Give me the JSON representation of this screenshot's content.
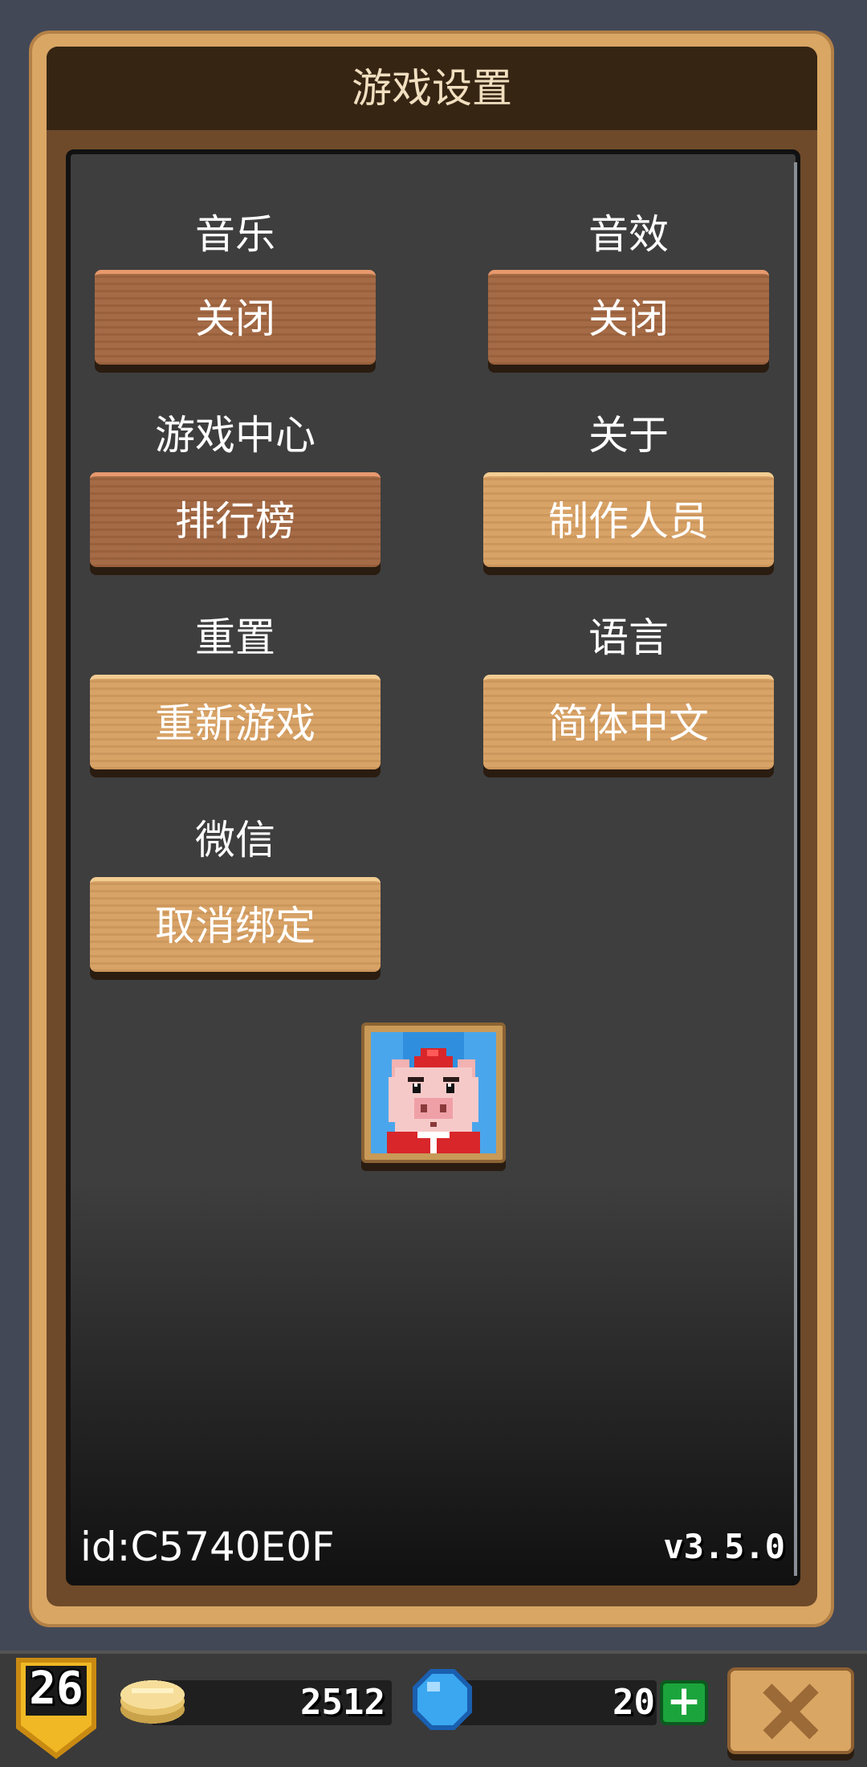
{
  "panel": {
    "title": "游戏设置"
  },
  "settings": {
    "music": {
      "label": "音乐",
      "value": "关闭"
    },
    "sound_effects": {
      "label": "音效",
      "value": "关闭"
    },
    "game_center": {
      "label": "游戏中心",
      "button": "排行榜"
    },
    "about": {
      "label": "关于",
      "button": "制作人员"
    },
    "reset": {
      "label": "重置",
      "button": "重新游戏"
    },
    "language": {
      "label": "语言",
      "button": "简体中文"
    },
    "wechat": {
      "label": "微信",
      "button": "取消绑定"
    }
  },
  "footer": {
    "user_id": "id:C5740E0F",
    "version": "v3.5.0"
  },
  "status_bar": {
    "level": "26",
    "coins": "2512",
    "gems": "20",
    "plus_label": "+"
  },
  "colors": {
    "frame": "#d9a664",
    "header": "#372514",
    "content_bg": "#3e3e3e",
    "wood_dark": "#a1653f",
    "wood_light": "#d79f61",
    "level_badge": "#f0b824",
    "add_button": "#1ca43c",
    "gem": "#3aa7f0",
    "coin": "#f1d58a"
  },
  "icons": {
    "avatar": "pig-avatar-icon",
    "level": "shield-badge-icon",
    "coin": "coin-stack-icon",
    "gem": "blue-gem-icon",
    "close": "close-x-icon"
  }
}
